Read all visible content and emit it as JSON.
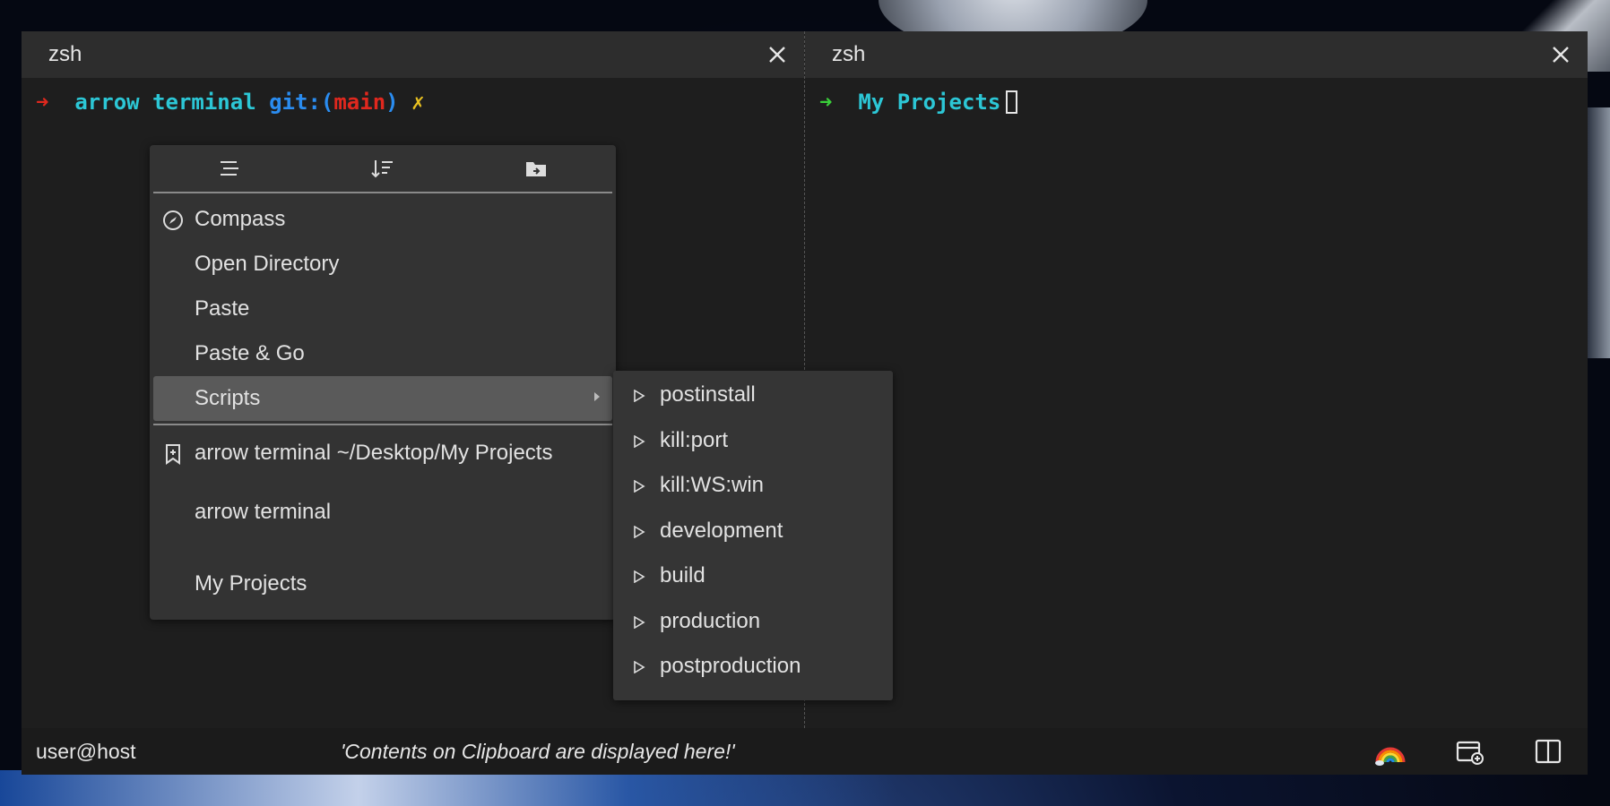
{
  "left_pane": {
    "tab_title": "zsh",
    "prompt": {
      "arrow": "➜",
      "dir": "arrow terminal",
      "git_open": "git:(",
      "branch": "main",
      "git_close": ")",
      "dirty": "✗"
    }
  },
  "right_pane": {
    "tab_title": "zsh",
    "prompt": {
      "arrow": "➜",
      "dir": "My Projects"
    }
  },
  "context_menu": {
    "tab_icons": [
      "list-icon",
      "sort-icon",
      "folder-open-icon"
    ],
    "items": [
      "Compass",
      "Open Directory",
      "Paste",
      "Paste & Go",
      "Scripts"
    ],
    "bookmark": "arrow terminal ~/Desktop/My Projects",
    "recent": [
      "arrow terminal",
      "My Projects"
    ]
  },
  "scripts_submenu": [
    "postinstall",
    "kill:port",
    "kill:WS:win",
    "development",
    "build",
    "production",
    "postproduction"
  ],
  "status_bar": {
    "user": "user@host",
    "clipboard": "'Contents on Clipboard are displayed here!'",
    "icons": [
      "rainbow-icon",
      "new-tab-icon",
      "split-pane-icon"
    ]
  }
}
